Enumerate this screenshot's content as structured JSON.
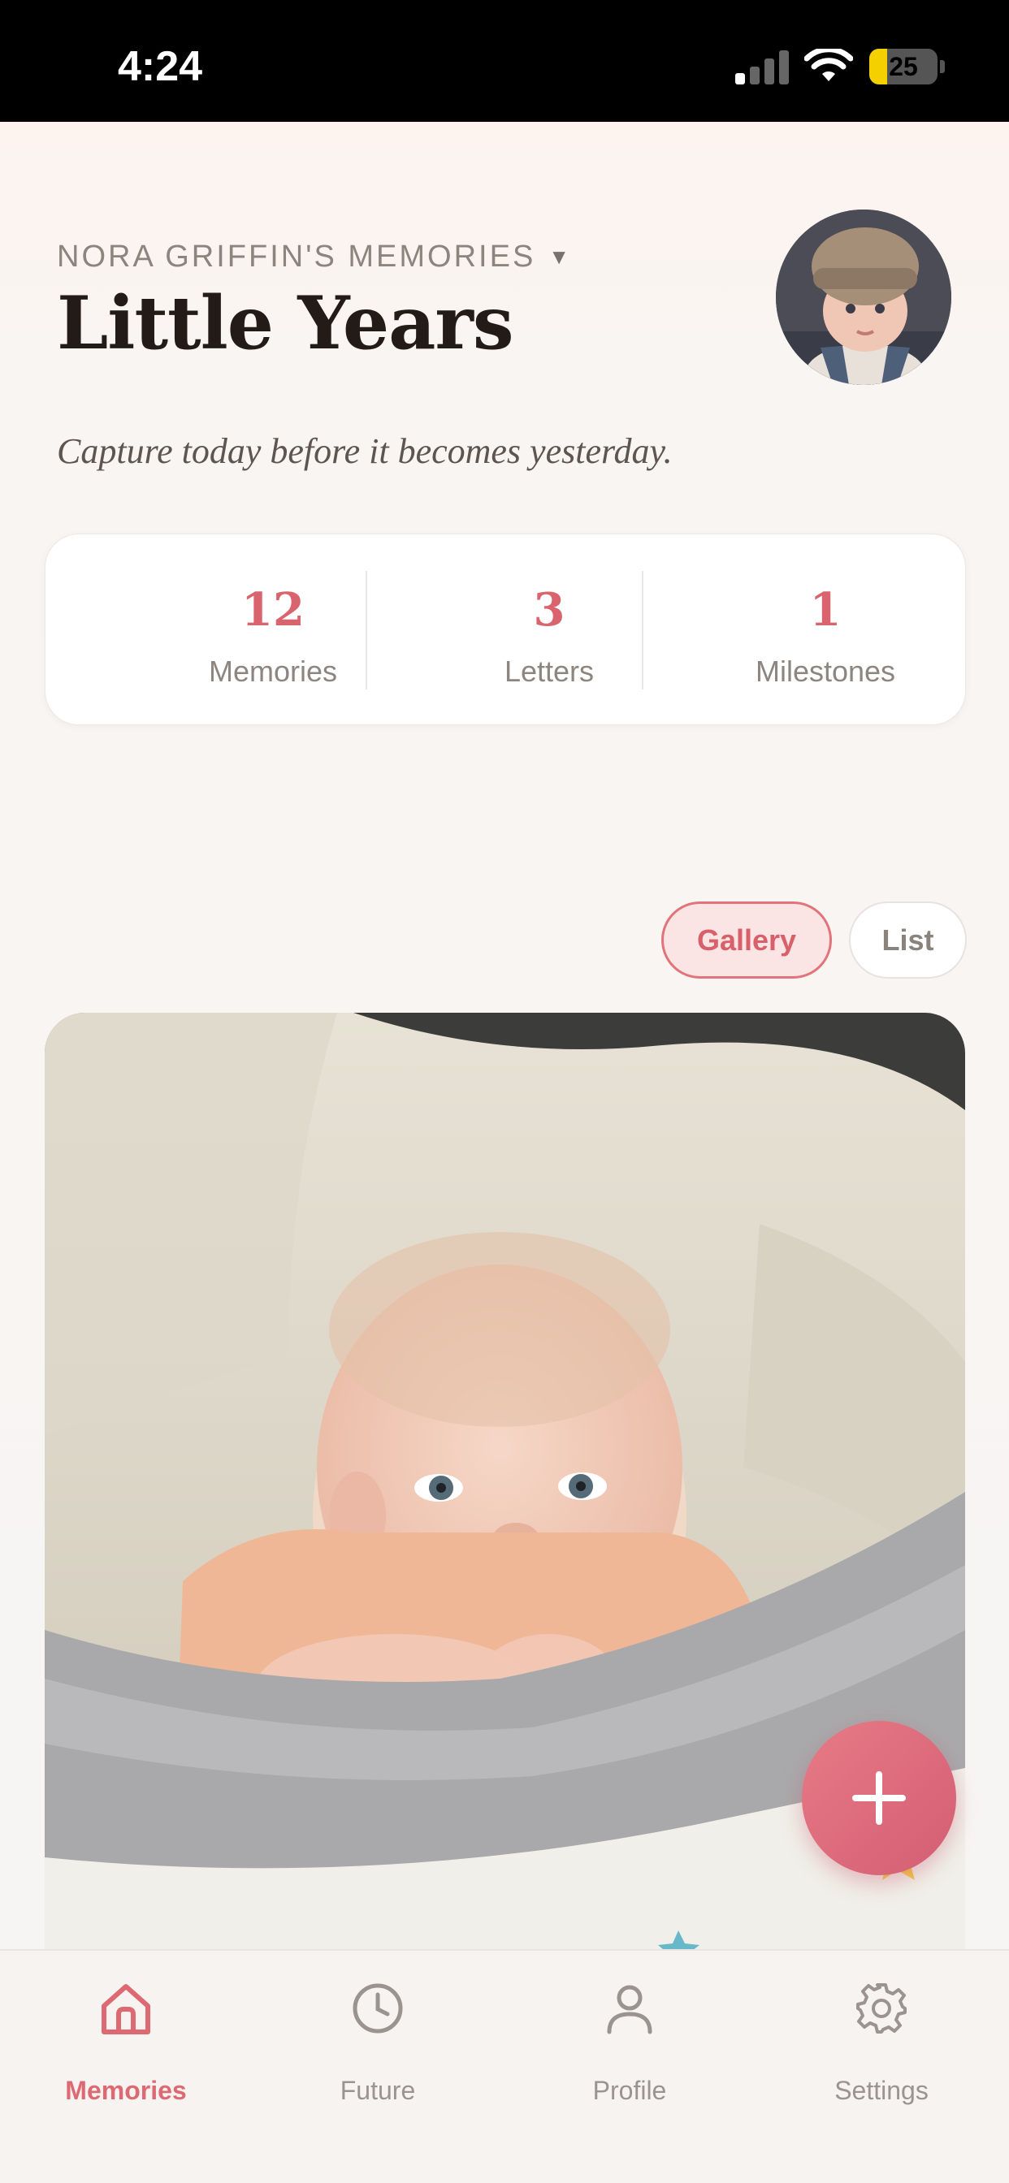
{
  "status_bar": {
    "time": "4:24",
    "battery": "25",
    "icons": [
      "signal-icon",
      "wifi-icon",
      "battery-icon"
    ]
  },
  "header": {
    "owner": "NORA GRIFFIN'S MEMORIES",
    "title": "Little Years",
    "tagline": "Capture today before it becomes yesterday."
  },
  "stats": [
    {
      "value": "12",
      "label": "Memories"
    },
    {
      "value": "3",
      "label": "Letters"
    },
    {
      "value": "1",
      "label": "Milestones"
    }
  ],
  "view_toggle": {
    "gallery": "Gallery",
    "list": "List",
    "selected": "Gallery"
  },
  "fab": {
    "icon": "plus-icon"
  },
  "tabs": [
    {
      "label": "Memories",
      "icon": "home-icon",
      "active": true
    },
    {
      "label": "Future",
      "icon": "clock-icon",
      "active": false
    },
    {
      "label": "Profile",
      "icon": "person-icon",
      "active": false
    },
    {
      "label": "Settings",
      "icon": "gear-icon",
      "active": false
    }
  ],
  "colors": {
    "accent": "#dd6a72",
    "title": "#231b17",
    "muted": "#8d8580",
    "background": "#f8f5f3"
  }
}
